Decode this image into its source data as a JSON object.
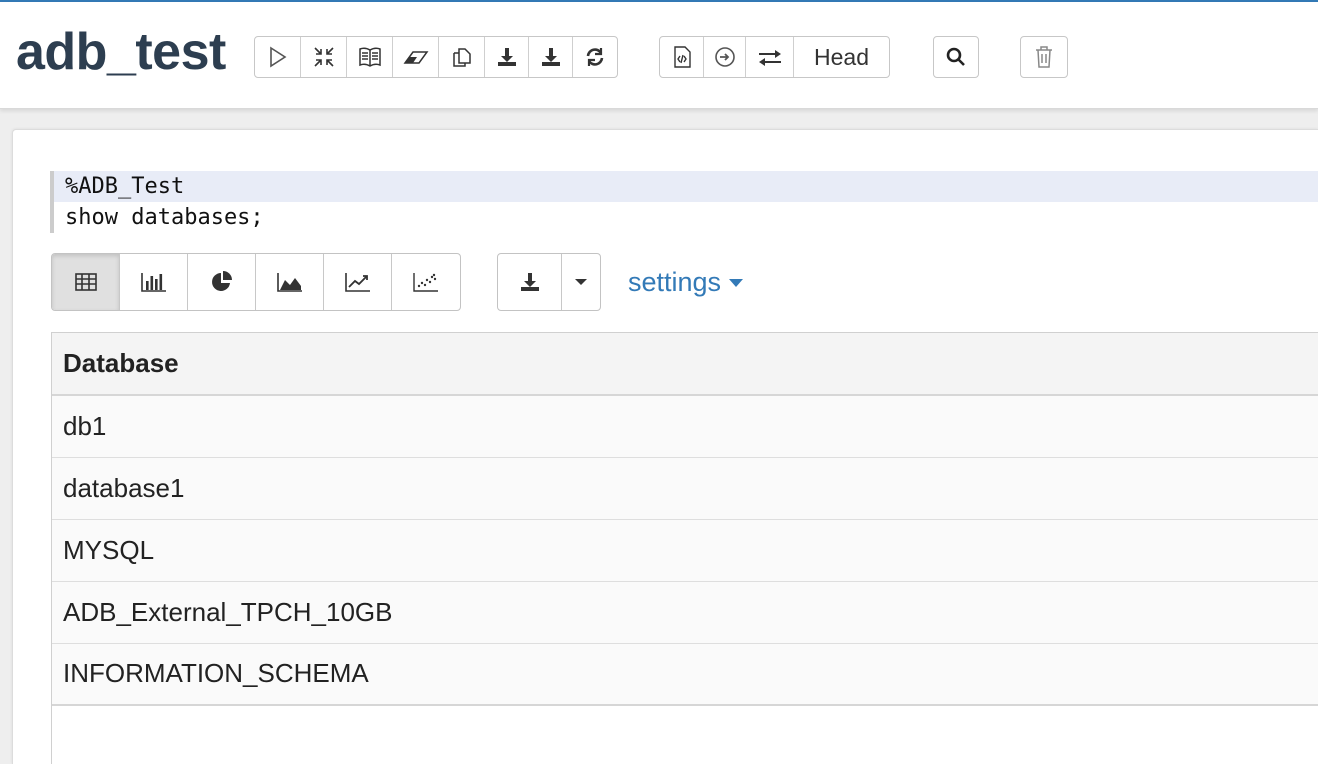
{
  "notebook": {
    "title": "adb_test"
  },
  "toolbar": {
    "head_label": "Head",
    "icons": {
      "run_all": "play-icon",
      "collapse": "compress-icon",
      "book": "book-icon",
      "clear": "eraser-icon",
      "clone": "copy-icon",
      "export": "download-icon",
      "export_alt": "download-icon",
      "reload": "refresh-icon",
      "code": "code-file-icon",
      "commit": "circle-arrow-icon",
      "version": "swap-icon",
      "search": "search-icon",
      "delete": "trash-icon"
    }
  },
  "paragraph": {
    "code_lines": [
      "%ADB_Test",
      "show databases;"
    ],
    "settings_label": "settings",
    "viz_buttons": [
      {
        "icon": "table-icon",
        "active": true
      },
      {
        "icon": "bar-chart-icon",
        "active": false
      },
      {
        "icon": "pie-chart-icon",
        "active": false
      },
      {
        "icon": "area-chart-icon",
        "active": false
      },
      {
        "icon": "line-chart-icon",
        "active": false
      },
      {
        "icon": "scatter-chart-icon",
        "active": false
      }
    ],
    "result": {
      "columns": [
        "Database"
      ],
      "rows": [
        [
          "db1"
        ],
        [
          "database1"
        ],
        [
          "MYSQL"
        ],
        [
          "ADB_External_TPCH_10GB"
        ],
        [
          "INFORMATION_SCHEMA"
        ]
      ]
    }
  },
  "colors": {
    "accent": "#337ab7",
    "title": "#2d3e50",
    "editor_active_line": "#e8ecf7"
  }
}
